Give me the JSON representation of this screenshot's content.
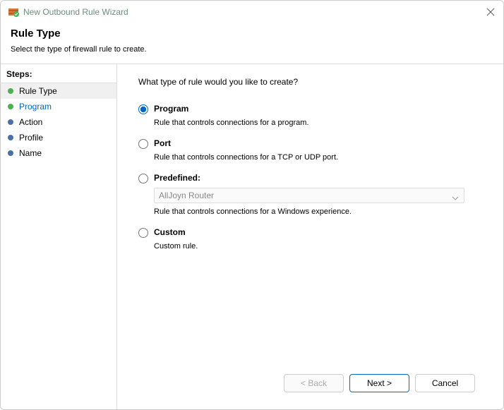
{
  "window": {
    "title": "New Outbound Rule Wizard"
  },
  "header": {
    "title": "Rule Type",
    "subtitle": "Select the type of firewall rule to create."
  },
  "sidebar": {
    "heading": "Steps:",
    "items": [
      {
        "label": "Rule Type",
        "state": "current",
        "link": false
      },
      {
        "label": "Program",
        "state": "done",
        "link": true
      },
      {
        "label": "Action",
        "state": "future",
        "link": false
      },
      {
        "label": "Profile",
        "state": "future",
        "link": false
      },
      {
        "label": "Name",
        "state": "future",
        "link": false
      }
    ]
  },
  "main": {
    "prompt": "What type of rule would you like to create?",
    "options": [
      {
        "value": "program",
        "label": "Program",
        "desc": "Rule that controls connections for a program.",
        "selected": true
      },
      {
        "value": "port",
        "label": "Port",
        "desc": "Rule that controls connections for a TCP or UDP port.",
        "selected": false
      },
      {
        "value": "predefined",
        "label": "Predefined:",
        "desc": "Rule that controls connections for a Windows experience.",
        "selected": false,
        "dropdown_value": "AllJoyn Router"
      },
      {
        "value": "custom",
        "label": "Custom",
        "desc": "Custom rule.",
        "selected": false
      }
    ]
  },
  "footer": {
    "back": "< Back",
    "next": "Next >",
    "cancel": "Cancel"
  }
}
